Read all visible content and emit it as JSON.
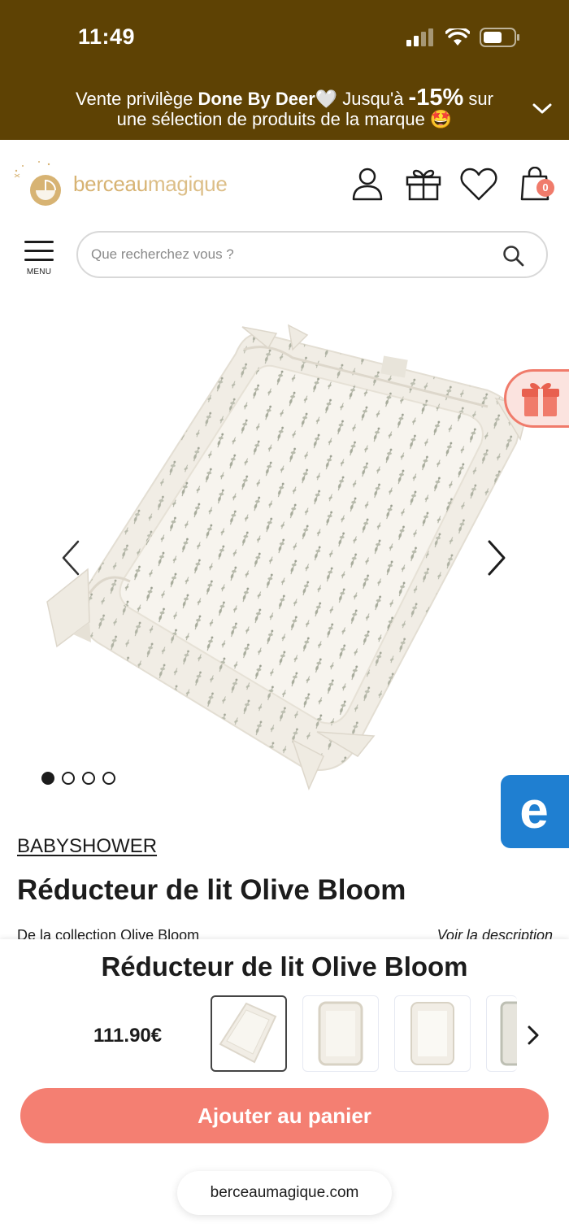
{
  "status_bar": {
    "time": "11:49"
  },
  "promo": {
    "line1_prefix": "Vente privilège ",
    "brand": "Done By Deer",
    "heart": "🤍",
    "line1_mid": " Jusqu'à ",
    "discount": "-15%",
    "line1_suffix": " sur",
    "line2": "une sélection de produits de la marque 🤩"
  },
  "header": {
    "logo_bold": "berceau",
    "logo_light": "magique",
    "cart_count": "0"
  },
  "menu": {
    "label": "MENU"
  },
  "search": {
    "placeholder": "Que recherchez vous ?"
  },
  "product": {
    "brand": "BABYSHOWER",
    "title": "Réducteur de lit Olive Bloom",
    "collection": "De la collection Olive Bloom",
    "see_description": "Voir la description"
  },
  "sticky": {
    "title": "Réducteur de lit Olive Bloom",
    "price": "111.90€",
    "add_to_cart": "Ajouter au panier"
  },
  "browser": {
    "url": "berceaumagique.com"
  },
  "colors": {
    "top_brown": "#5e4204",
    "brand_gold": "#d7b373",
    "coral": "#f47f72",
    "blue_badge": "#1f7fd1"
  },
  "icons": [
    "signal-icon",
    "wifi-icon",
    "battery-icon",
    "chevron-down-icon",
    "account-icon",
    "gift-icon",
    "heart-icon",
    "bag-icon",
    "search-icon",
    "chevron-left-icon",
    "chevron-right-icon"
  ]
}
